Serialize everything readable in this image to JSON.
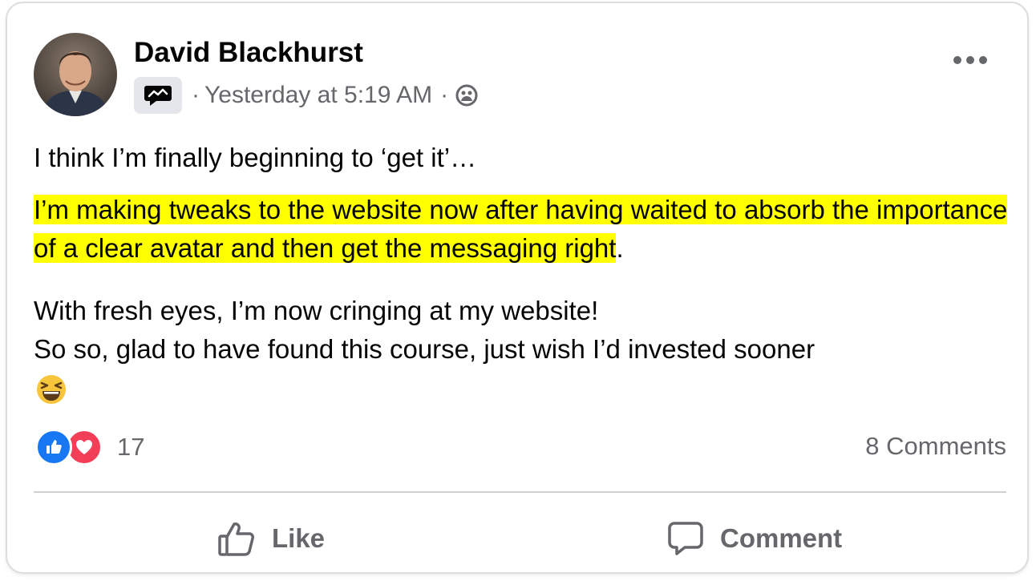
{
  "post": {
    "author": "David Blackhurst",
    "badge_icon": "community-badge-icon",
    "separator1": "·",
    "timestamp": "Yesterday at 5:19 AM",
    "separator2": "·",
    "audience_icon": "group-audience-icon",
    "menu_icon": "more-options-icon",
    "paragraph1": "I think I’m finally beginning to ‘get it’…",
    "paragraph2_highlighted": "I’m making tweaks to the website now after having waited to absorb the importance of a clear avatar and then get the messaging right",
    "paragraph2_tail": ".",
    "paragraph3_line1": "With fresh eyes, I’m now cringing at my website!",
    "paragraph3_line2": "So so, glad to have found this course, just wish I’d invested sooner",
    "emoji": "😆",
    "highlight_color": "#ffff00"
  },
  "stats": {
    "reactions": [
      "like",
      "love"
    ],
    "reaction_count": "17",
    "comments": "8 Comments"
  },
  "actions": {
    "like_label": "Like",
    "like_icon": "thumbs-up-icon",
    "comment_label": "Comment",
    "comment_icon": "speech-bubble-icon"
  },
  "colors": {
    "like_blue": "#1877f2",
    "love_red": "#f33e58",
    "secondary_text": "#65676b"
  }
}
